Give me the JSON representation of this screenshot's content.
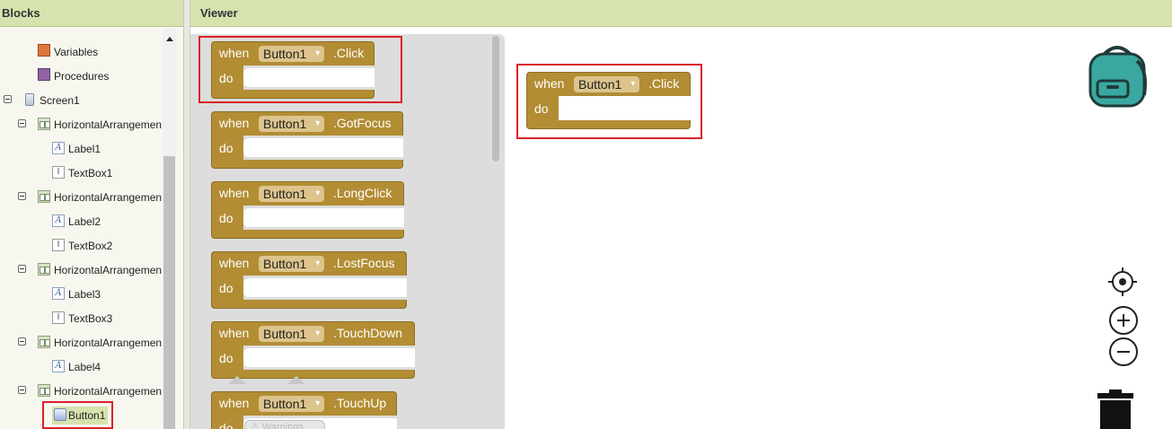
{
  "blocks_panel": {
    "title": "Blocks",
    "tree": [
      {
        "label": "Variables",
        "icon": "variables-square-icon"
      },
      {
        "label": "Procedures",
        "icon": "procedures-square-icon"
      },
      {
        "label": "Screen1",
        "icon": "screen-icon"
      },
      {
        "label": "HorizontalArrangemen",
        "icon": "horizontal-arrangement-icon"
      },
      {
        "label": "Label1",
        "icon": "label-icon"
      },
      {
        "label": "TextBox1",
        "icon": "textbox-icon"
      },
      {
        "label": "HorizontalArrangemen",
        "icon": "horizontal-arrangement-icon"
      },
      {
        "label": "Label2",
        "icon": "label-icon"
      },
      {
        "label": "TextBox2",
        "icon": "textbox-icon"
      },
      {
        "label": "HorizontalArrangemen",
        "icon": "horizontal-arrangement-icon"
      },
      {
        "label": "Label3",
        "icon": "label-icon"
      },
      {
        "label": "TextBox3",
        "icon": "textbox-icon"
      },
      {
        "label": "HorizontalArrangemen",
        "icon": "horizontal-arrangement-icon"
      },
      {
        "label": "Label4",
        "icon": "label-icon"
      },
      {
        "label": "HorizontalArrangemen",
        "icon": "horizontal-arrangement-icon"
      },
      {
        "label": "Button1",
        "icon": "button-icon"
      }
    ]
  },
  "viewer": {
    "title": "Viewer",
    "flyout_blocks": [
      {
        "when": "when",
        "component": "Button1",
        "event": ".Click",
        "do": "do"
      },
      {
        "when": "when",
        "component": "Button1",
        "event": ".GotFocus",
        "do": "do"
      },
      {
        "when": "when",
        "component": "Button1",
        "event": ".LongClick",
        "do": "do"
      },
      {
        "when": "when",
        "component": "Button1",
        "event": ".LostFocus",
        "do": "do"
      },
      {
        "when": "when",
        "component": "Button1",
        "event": ".TouchDown",
        "do": "do"
      },
      {
        "when": "when",
        "component": "Button1",
        "event": ".TouchUp",
        "do": "do"
      }
    ],
    "workspace_block": {
      "when": "when",
      "component": "Button1",
      "event": ".Click",
      "do": "do"
    },
    "ghost_warning": "⚠ Warnings"
  },
  "colors": {
    "event_block": "#b28d33",
    "highlight": "#d9222a",
    "header_bar": "#d6e3ae",
    "backpack": "#3aa8a0"
  }
}
